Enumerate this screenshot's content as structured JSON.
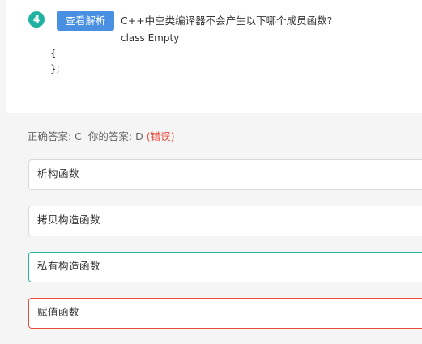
{
  "question": {
    "number": "4",
    "analysis_button_label": "查看解析",
    "text": "C++中空类编译器不会产生以下哪个成员函数?",
    "code_lines": [
      "class Empty",
      "{",
      "};"
    ]
  },
  "answer_summary": {
    "correct_prefix": "正确答案: C",
    "your_prefix": "你的答案: D",
    "result": "(错误)"
  },
  "options": [
    {
      "label": "析构函数",
      "state": "normal"
    },
    {
      "label": "拷贝构造函数",
      "state": "normal"
    },
    {
      "label": "私有构造函数",
      "state": "correct"
    },
    {
      "label": "赋值函数",
      "state": "wrong"
    }
  ],
  "colors": {
    "accent_teal": "#20b2a0",
    "button_blue": "#4a90e2",
    "error_red": "#e74c3c"
  }
}
